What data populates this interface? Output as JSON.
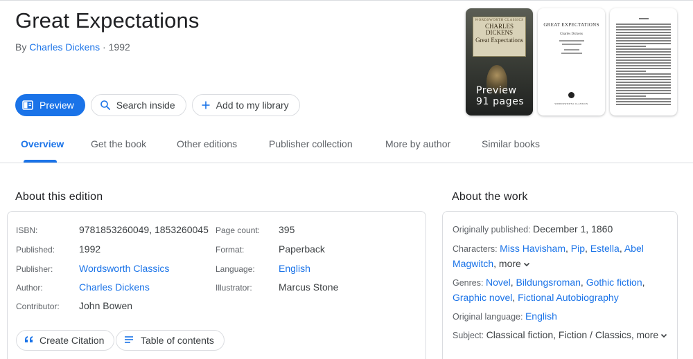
{
  "book": {
    "title": "Great Expectations",
    "by_prefix": "By",
    "author": "Charles Dickens",
    "year_sep": " · ",
    "year": "1992"
  },
  "actions": {
    "preview": "Preview",
    "search_inside": "Search inside",
    "add_library": "Add to my library"
  },
  "thumbnails": {
    "cover_series": "WORDSWORTH CLASSICS",
    "cover_author": "CHARLES DICKENS",
    "cover_title": "Great Expectations",
    "preview_label": "Preview",
    "preview_pages": "91 pages",
    "title_page_title": "GREAT EXPECTATIONS",
    "title_page_author": "Charles Dickens",
    "title_page_publisher": "WORDSWORTH CLASSICS"
  },
  "tabs": [
    "Overview",
    "Get the book",
    "Other editions",
    "Publisher collection",
    "More by author",
    "Similar books"
  ],
  "edition": {
    "heading": "About this edition",
    "left": [
      {
        "label": "ISBN:",
        "value": "9781853260049, 1853260045",
        "link": false
      },
      {
        "label": "Published:",
        "value": "1992",
        "link": false
      },
      {
        "label": "Publisher:",
        "value": "Wordsworth Classics",
        "link": true
      },
      {
        "label": "Author:",
        "value": "Charles Dickens",
        "link": true
      },
      {
        "label": "Contributor:",
        "value": "John Bowen",
        "link": false
      }
    ],
    "right": [
      {
        "label": "Page count:",
        "value": "395",
        "link": false
      },
      {
        "label": "Format:",
        "value": "Paperback",
        "link": false
      },
      {
        "label": "Language:",
        "value": "English",
        "link": true
      },
      {
        "label": "Illustrator:",
        "value": "Marcus Stone",
        "link": false
      }
    ],
    "create_citation": "Create Citation",
    "table_of_contents": "Table of contents"
  },
  "work": {
    "heading": "About the work",
    "originally_label": "Originally published:",
    "originally_value": "December 1, 1860",
    "characters_label": "Characters:",
    "characters": [
      "Miss Havisham",
      "Pip",
      "Estella",
      "Abel Magwitch"
    ],
    "characters_more": "more",
    "genres_label": "Genres:",
    "genres": [
      "Novel",
      "Bildungsroman",
      "Gothic fiction",
      "Graphic novel",
      "Fictional Autobiography"
    ],
    "language_label": "Original language:",
    "language_value": "English",
    "subject_label": "Subject:",
    "subject_value": "Classical fiction, Fiction / Classics,",
    "subject_more": "more"
  },
  "colors": {
    "accent": "#1a73e8",
    "text": "#202124",
    "muted": "#5f6368",
    "border": "#dadce0"
  }
}
